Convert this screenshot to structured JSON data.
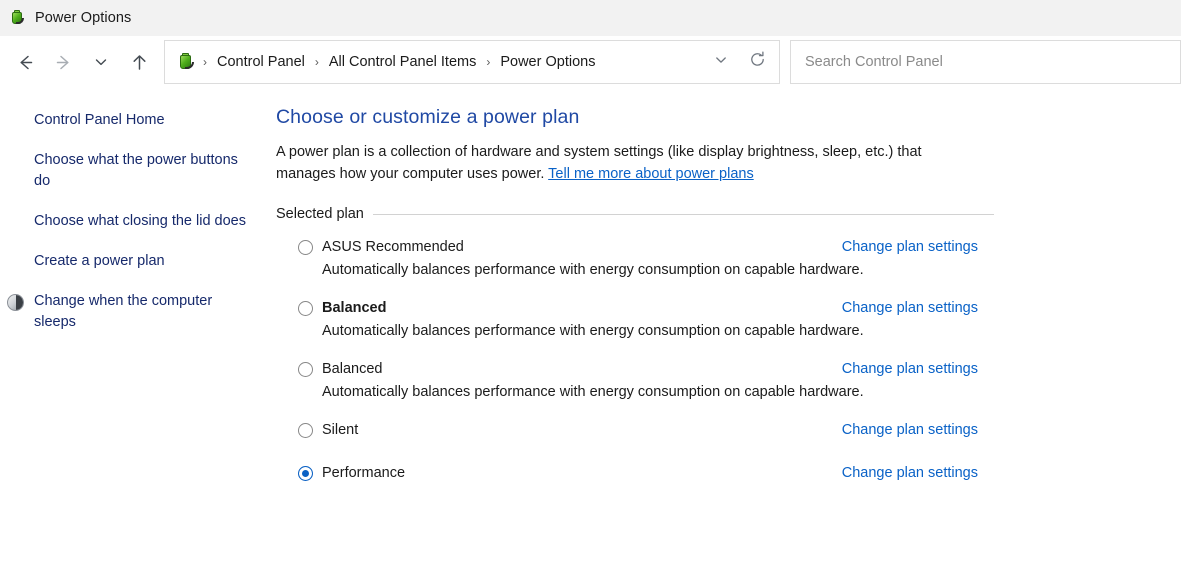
{
  "window": {
    "title": "Power Options",
    "icon": "power-plug-icon"
  },
  "nav": {
    "back_icon": "arrow-left-icon",
    "forward_icon": "arrow-right-icon",
    "recent_icon": "chevron-down-icon",
    "up_icon": "arrow-up-icon",
    "history_icon": "chevron-down-icon",
    "refresh_icon": "refresh-icon"
  },
  "address": {
    "icon": "power-plug-icon",
    "separator": "›",
    "crumbs": [
      {
        "label": "Control Panel"
      },
      {
        "label": "All Control Panel Items"
      },
      {
        "label": "Power Options"
      }
    ]
  },
  "search": {
    "placeholder": "Search Control Panel",
    "value": ""
  },
  "sidebar": {
    "home": {
      "label": "Control Panel Home"
    },
    "items": [
      {
        "label": "Choose what the power buttons do",
        "icon": null
      },
      {
        "label": "Choose what closing the lid does",
        "icon": null
      },
      {
        "label": "Create a power plan",
        "icon": null
      },
      {
        "label": "Change when the computer sleeps",
        "icon": "sleep-shield-icon"
      }
    ]
  },
  "main": {
    "heading": "Choose or customize a power plan",
    "description_part1": "A power plan is a collection of hardware and system settings (like display brightness, sleep, etc.) that manages how your computer uses power. ",
    "description_link": "Tell me more about power plans",
    "group_label": "Selected plan",
    "change_link_label": "Change plan settings",
    "plans": [
      {
        "name": "ASUS Recommended",
        "selected": false,
        "bold": false,
        "description": "Automatically balances performance with energy consumption on capable hardware.",
        "change_label": "Change plan settings"
      },
      {
        "name": "Balanced",
        "selected": false,
        "bold": true,
        "description": "Automatically balances performance with energy consumption on capable hardware.",
        "change_label": "Change plan settings"
      },
      {
        "name": "Balanced",
        "selected": false,
        "bold": false,
        "description": "Automatically balances performance with energy consumption on capable hardware.",
        "change_label": "Change plan settings"
      },
      {
        "name": "Silent",
        "selected": false,
        "bold": false,
        "description": "",
        "change_label": "Change plan settings"
      },
      {
        "name": "Performance",
        "selected": true,
        "bold": false,
        "description": "",
        "change_label": "Change plan settings"
      }
    ]
  },
  "colors": {
    "titlebar_bg": "#f2f2f2",
    "heading": "#2049a4",
    "link": "#0a62c7",
    "sidebar_link": "#16296b",
    "radio_selected": "#0b61c4",
    "text": "#1b1b1b"
  }
}
